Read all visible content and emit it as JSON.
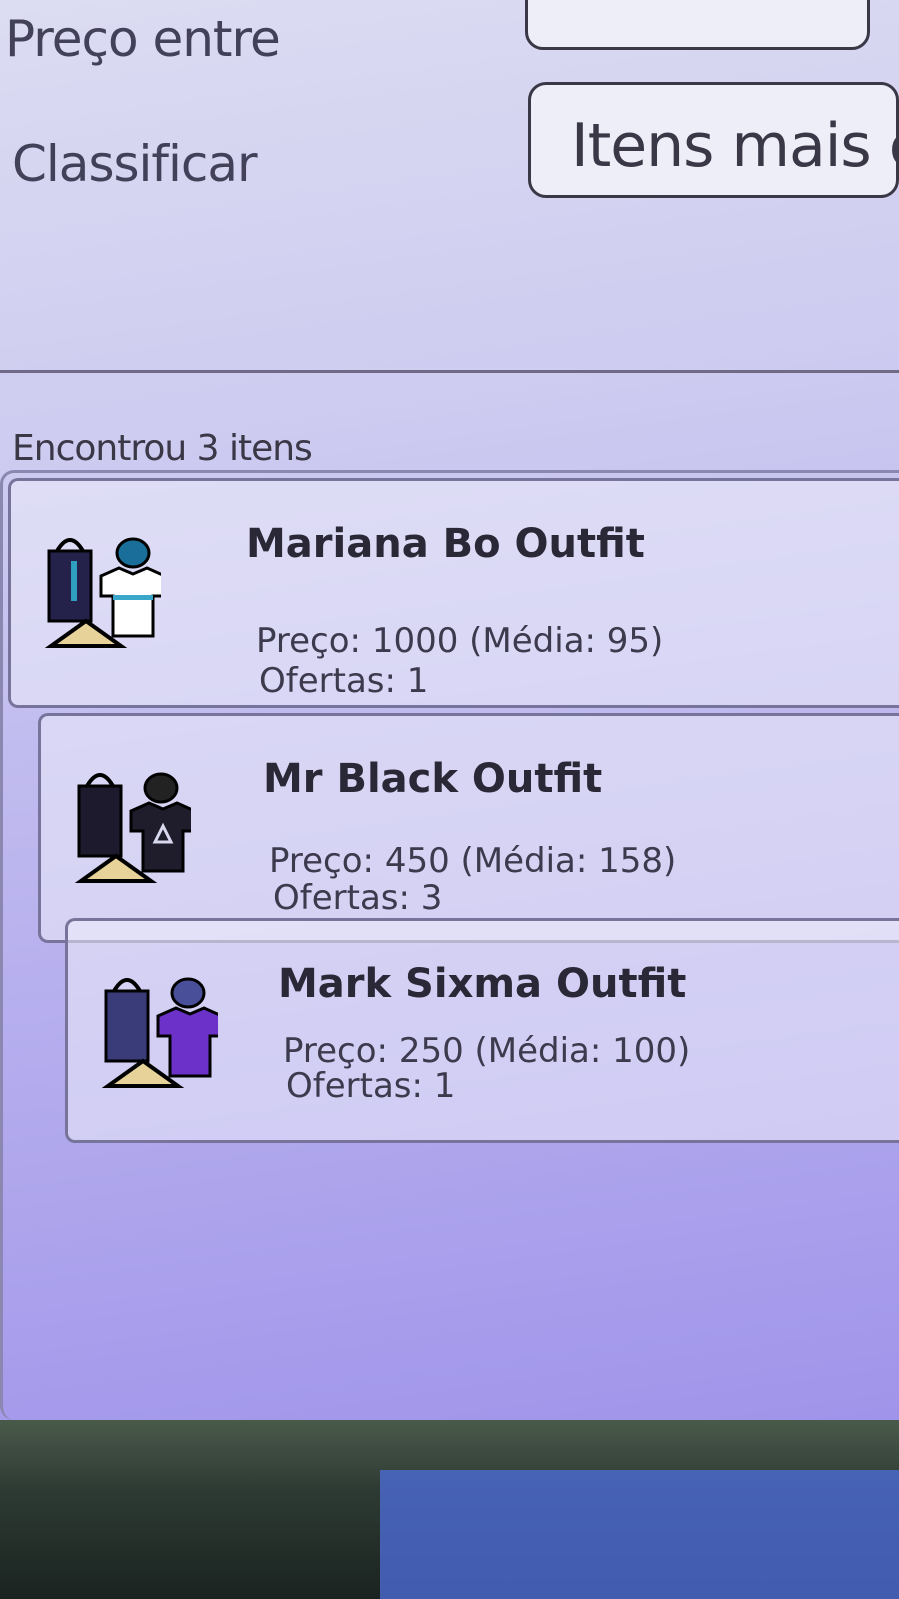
{
  "filters": {
    "price_label": "Preço entre",
    "sort_label": "Classificar",
    "sort_value": "Itens mais c"
  },
  "results": {
    "count_text": "Encontrou 3 itens",
    "items": [
      {
        "name": "Mariana Bo Outfit",
        "price": "Preço: 1000 (Média: 95)",
        "offers": "Ofertas: 1",
        "icon": "outfit-icon",
        "shirt_color": "#ffffff"
      },
      {
        "name": "Mr Black Outfit",
        "price": "Preço: 450 (Média: 158)",
        "offers": "Ofertas: 3",
        "icon": "outfit-icon",
        "shirt_color": "#1f1c2b"
      },
      {
        "name": "Mark Sixma Outfit",
        "price": "Preço: 250 (Média: 100)",
        "offers": "Ofertas: 1",
        "icon": "outfit-icon",
        "shirt_color": "#6b31c9"
      }
    ]
  }
}
